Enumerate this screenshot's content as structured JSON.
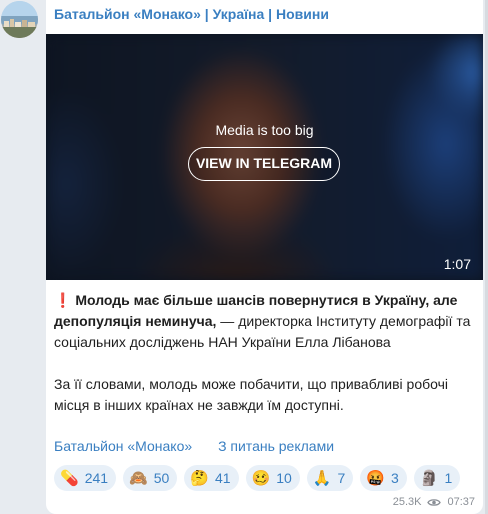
{
  "channel": {
    "name": "Батальйон «Монако» | Україна | Новини"
  },
  "media": {
    "note": "Media is too big",
    "button_label": "VIEW IN TELEGRAM",
    "duration": "1:07"
  },
  "post": {
    "bold_icon": "❗️",
    "bold_text": "Молодь має більше шансів повернутися в Україну, але депопуляція неминуча,",
    "rest_text": " — директорка Інституту демографії та соціальних досліджень НАН України Елла Лібанова",
    "paragraph2": "За її словами, молодь може побачити, що привабливі робочі місця в інших країнах не завжди їм доступні."
  },
  "links": {
    "channel_link": "Батальйон «Монако»",
    "ads_link": "З питань реклами"
  },
  "reactions": [
    {
      "icon": "pill-icon",
      "emoji": "💊",
      "count": "241"
    },
    {
      "icon": "monkey-icon",
      "emoji": "🙈",
      "count": "50"
    },
    {
      "icon": "thinking-face-icon",
      "emoji": "🤔",
      "count": "41"
    },
    {
      "icon": "woozy-face-icon",
      "emoji": "🥴",
      "count": "10"
    },
    {
      "icon": "folded-hands-icon",
      "emoji": "🙏",
      "count": "7"
    },
    {
      "icon": "angry-face-icon",
      "emoji": "🤬",
      "count": "3"
    },
    {
      "icon": "moai-icon",
      "emoji": "🗿",
      "count": "1"
    }
  ],
  "meta": {
    "views": "25.3K",
    "time": "07:37"
  },
  "colors": {
    "accent": "#3a7fc1",
    "background": "#e7ebf0",
    "card": "#ffffff",
    "reaction_bg": "#e8f0f8"
  }
}
